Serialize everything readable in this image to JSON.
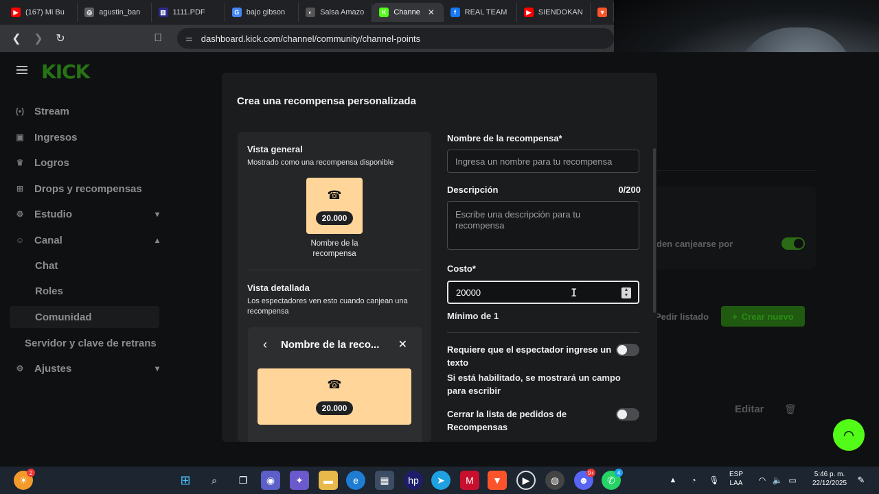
{
  "browser": {
    "tabs": [
      {
        "label": "(167) Mi Bu",
        "fav_color": "#ff0000",
        "fav_glyph": "▶",
        "active": false
      },
      {
        "label": "agustin_ban",
        "fav_color": "#5f6368",
        "fav_glyph": "◎",
        "active": false
      },
      {
        "label": "1111.PDF",
        "fav_color": "#2b2b8f",
        "fav_glyph": "▥",
        "active": false
      },
      {
        "label": "bajo gibson",
        "fav_color": "#4285f4",
        "fav_glyph": "G",
        "active": false
      },
      {
        "label": "Salsa Amazo",
        "fav_color": "#555",
        "fav_glyph": "◐",
        "active": false
      },
      {
        "label": "Channe",
        "fav_color": "#53fc18",
        "fav_glyph": "K",
        "active": true
      },
      {
        "label": "REAL TEAM",
        "fav_color": "#1877f2",
        "fav_glyph": "f",
        "active": false
      },
      {
        "label": "SIENDOKAN",
        "fav_color": "#ff0000",
        "fav_glyph": "▶",
        "active": false
      },
      {
        "label": "",
        "fav_color": "#fb542b",
        "fav_glyph": "▼",
        "active": false
      }
    ],
    "url": "dashboard.kick.com/channel/community/channel-points"
  },
  "sidebar": {
    "logo": "KICK",
    "items": [
      {
        "label": "Stream",
        "icon": "broadcast-icon",
        "glyph": "((•))"
      },
      {
        "label": "Ingresos",
        "icon": "wallet-icon",
        "glyph": "▣"
      },
      {
        "label": "Logros",
        "icon": "trophy-icon",
        "glyph": "🏆"
      },
      {
        "label": "Drops y recompensas",
        "icon": "gift-icon",
        "glyph": "⊞"
      },
      {
        "label": "Estudio",
        "icon": "studio-icon",
        "glyph": "⚙"
      },
      {
        "label": "Canal",
        "icon": "people-icon",
        "glyph": "👥"
      }
    ],
    "subitems": [
      "Chat",
      "Roles",
      "Comunidad"
    ],
    "extra": "Servidor y clave de retrans",
    "settings": "Ajustes"
  },
  "background": {
    "redeem_text": "den canjearse por",
    "pedir": "Pedir listado",
    "crear": "Crear nuevo",
    "editar": "Editar"
  },
  "modal": {
    "title": "Crea una recompensa personalizada",
    "preview": {
      "general_title": "Vista general",
      "general_sub": "Mostrado como una recompensa disponible",
      "cost": "20.000",
      "reward_name": "Nombre de la recompensa",
      "detail_title": "Vista detallada",
      "detail_sub": "Los espectadores ven esto cuando canjean una recompensa",
      "detail_header": "Nombre de la reco..."
    },
    "form": {
      "name_label": "Nombre de la recompensa*",
      "name_placeholder": "Ingresa un nombre para tu recompensa",
      "desc_label": "Descripción",
      "desc_count": "0/200",
      "desc_placeholder": "Escribe una descripción para tu recompensa",
      "cost_label": "Costo*",
      "cost_value": "20000",
      "cost_hint": "Mínimo de 1",
      "require_text_label": "Requiere que el espectador ingrese un texto",
      "require_text_desc": "Si está habilitado, se mostrará un campo para escribir",
      "close_list_label": "Cerrar la lista de pedidos de Recompensas"
    }
  },
  "taskbar": {
    "language": "ESP",
    "layout": "LAA",
    "time": "5:46 p. m.",
    "date": "22/12/2025",
    "notif_badge": "2",
    "discord_badge": "9+",
    "whatsapp_badge": "4"
  }
}
